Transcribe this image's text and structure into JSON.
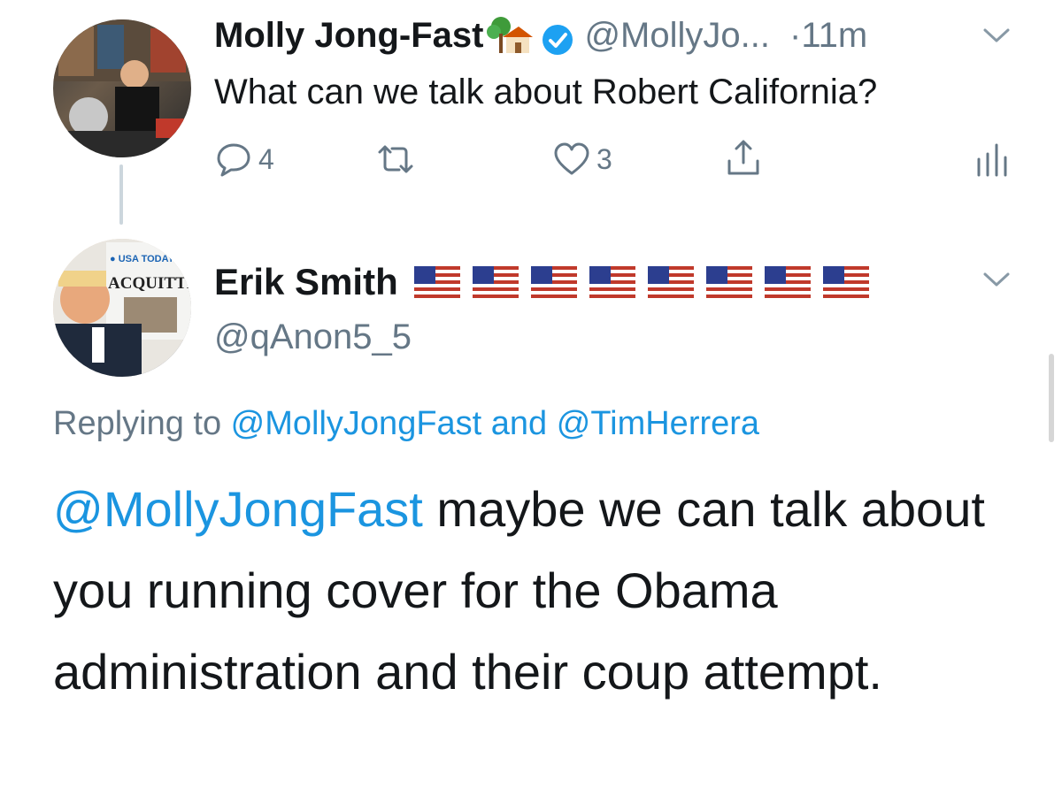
{
  "tweet1": {
    "author_name": "Molly Jong-Fast",
    "handle": "@MollyJo...",
    "dot": "·",
    "time": "11m",
    "text": "What can we talk about Robert California?",
    "reply_count": "4",
    "like_count": "3",
    "icons": {
      "house": "house-with-tree-emoji-icon",
      "verified": "verified-badge-icon",
      "more": "chevron-down-icon",
      "reply": "reply-bubble-icon",
      "retweet": "retweet-icon",
      "like": "heart-icon",
      "share": "share-icon",
      "stats": "analytics-icon"
    }
  },
  "tweet2": {
    "author_name": "Erik Smith",
    "flag_count_icon": "us-flag-emoji-icon",
    "handle": "@qAnon5_5",
    "replying_prefix": "Replying to ",
    "replying_user1": "@MollyJongFast",
    "replying_and": " and ",
    "replying_user2": "@TimHerrera",
    "mention": "@MollyJongFast",
    "text": " maybe we can talk about you running cover for the Obama administration and their coup attempt.",
    "icons": {
      "more": "chevron-down-icon"
    }
  },
  "colors": {
    "link": "#1b95e0",
    "secondary": "#657786",
    "primary_text": "#14171a",
    "verified": "#1da1f2"
  }
}
